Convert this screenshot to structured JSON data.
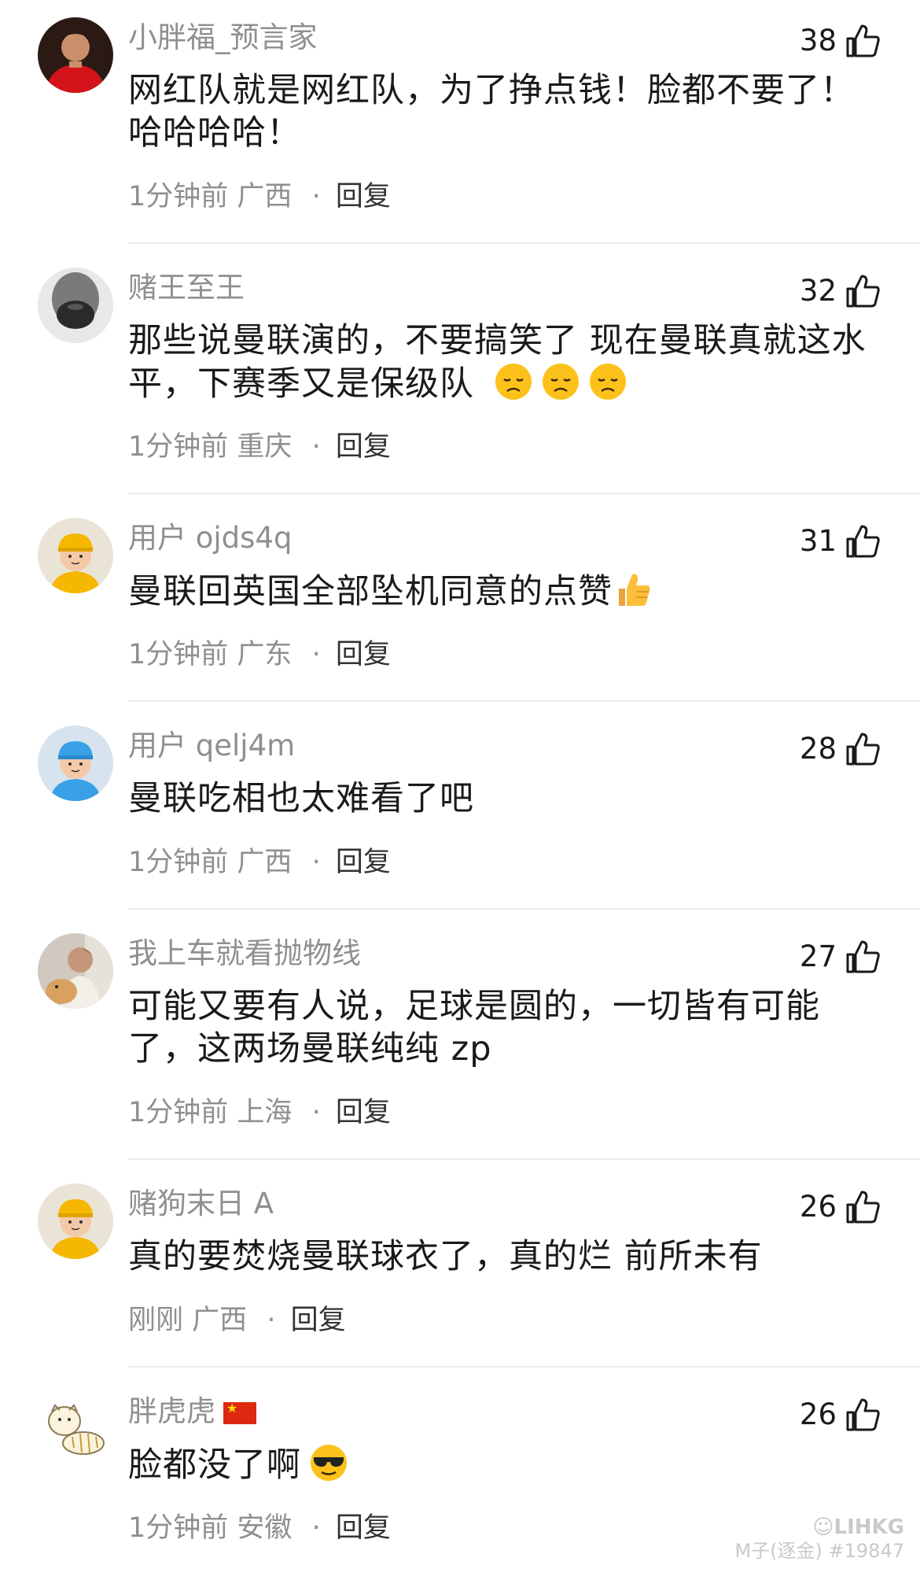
{
  "comments": [
    {
      "username": "小胖福_预言家",
      "likes": "38",
      "text": "网红队就是网红队，为了挣点钱！脸都不要了！哈哈哈哈！",
      "time": "1分钟前",
      "location": "广西",
      "reply_label": "回复",
      "avatar_icon": "football-player-avatar-icon"
    },
    {
      "username": "赌王至王",
      "likes": "32",
      "text": "那些说曼联演的，不要搞笑了 现在曼联真就这水平，下赛季又是保级队",
      "time": "1分钟前",
      "location": "重庆",
      "reply_label": "回复",
      "avatar_icon": "bearded-face-avatar-icon",
      "emojis": [
        "disappointed-face-emoji",
        "disappointed-face-emoji",
        "disappointed-face-emoji"
      ]
    },
    {
      "username": "用户 ojds4q",
      "likes": "31",
      "text": "曼联回英国全部坠机同意的点赞",
      "time": "1分钟前",
      "location": "广东",
      "reply_label": "回复",
      "avatar_icon": "yellow-cap-cartoon-avatar-icon",
      "emojis": [
        "thumbs-up-emoji"
      ]
    },
    {
      "username": "用户 qelj4m",
      "likes": "28",
      "text": "曼联吃相也太难看了吧",
      "time": "1分钟前",
      "location": "广西",
      "reply_label": "回复",
      "avatar_icon": "blue-cap-cartoon-avatar-icon"
    },
    {
      "username": "我上车就看抛物线",
      "likes": "27",
      "text": "可能又要有人说，足球是圆的，一切皆有可能了，这两场曼联纯纯 zp",
      "time": "1分钟前",
      "location": "上海",
      "reply_label": "回复",
      "avatar_icon": "man-with-dog-avatar-icon"
    },
    {
      "username": "赌狗末日 A",
      "likes": "26",
      "text": "真的要焚烧曼联球衣了，真的烂 前所未有",
      "time": "刚刚",
      "location": "广西",
      "reply_label": "回复",
      "avatar_icon": "yellow-cap-cartoon-avatar-icon"
    },
    {
      "username": "胖虎虎",
      "likes": "26",
      "text": "脸都没了啊",
      "time": "1分钟前",
      "location": "安徽",
      "reply_label": "回复",
      "avatar_icon": "tiger-cartoon-avatar-icon",
      "has_flag": true,
      "emojis": [
        "sunglasses-face-emoji"
      ]
    }
  ],
  "watermark": {
    "logo": "☺LIHKG",
    "credit": "M子(逐金) #19847"
  },
  "colors": {
    "text": "#1a1a1a",
    "muted": "#8f8f8f",
    "divider": "#ececec",
    "background": "#ffffff"
  }
}
